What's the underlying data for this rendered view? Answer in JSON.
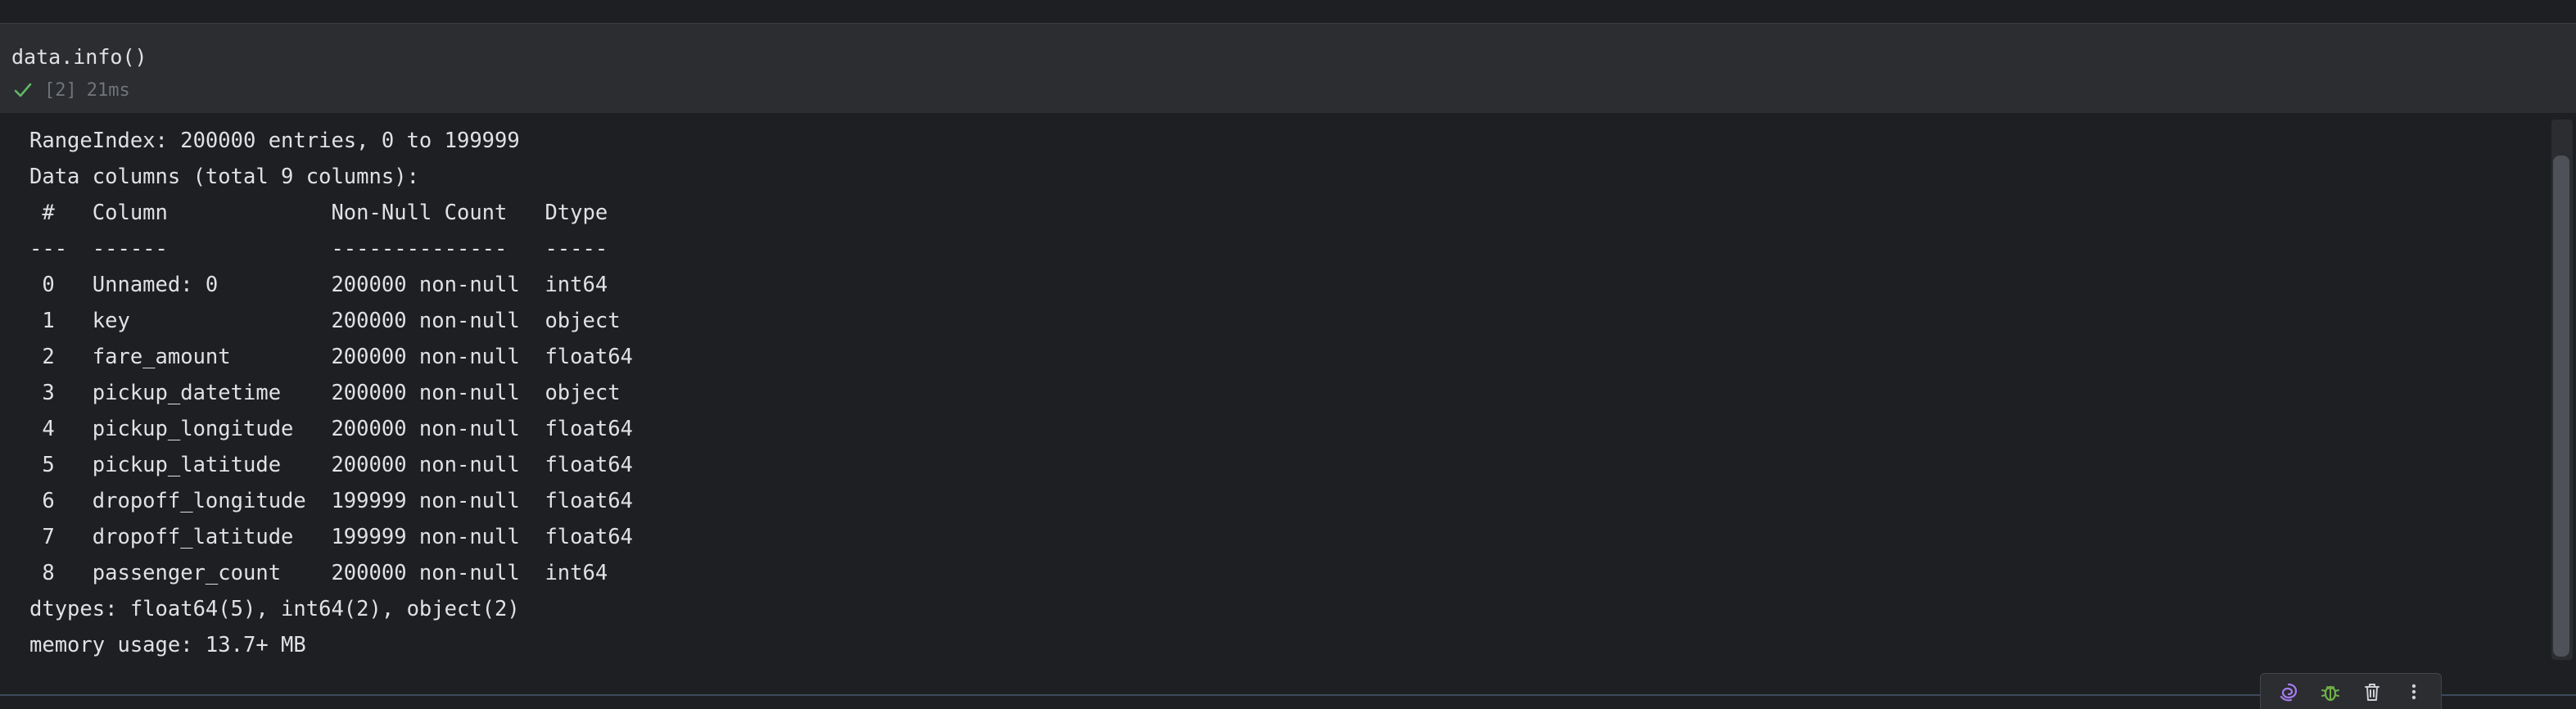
{
  "cell": {
    "code": "data.info()",
    "exec_count": "[2]",
    "duration": "21ms",
    "status_icon": "check-icon"
  },
  "output": {
    "lines": [
      "RangeIndex: 200000 entries, 0 to 199999",
      "Data columns (total 9 columns):",
      " #   Column             Non-Null Count   Dtype  ",
      "---  ------             --------------   -----  ",
      " 0   Unnamed: 0         200000 non-null  int64  ",
      " 1   key                200000 non-null  object ",
      " 2   fare_amount        200000 non-null  float64",
      " 3   pickup_datetime    200000 non-null  object ",
      " 4   pickup_longitude   200000 non-null  float64",
      " 5   pickup_latitude    200000 non-null  float64",
      " 6   dropoff_longitude  199999 non-null  float64",
      " 7   dropoff_latitude   199999 non-null  float64",
      " 8   passenger_count    200000 non-null  int64  ",
      "dtypes: float64(5), int64(2), object(2)",
      "memory usage: 13.7+ MB"
    ]
  },
  "toolbar": {
    "buttons": [
      {
        "icon": "ai-assistant-icon"
      },
      {
        "icon": "debug-icon"
      },
      {
        "icon": "trash-icon"
      },
      {
        "icon": "more-vertical-icon"
      }
    ]
  },
  "colors": {
    "background": "#1e1f22",
    "cell_input_bg": "#2b2d30",
    "text": "#dfe1e5",
    "muted_text": "#6f737a",
    "success_green": "#5fb865",
    "ai_purple": "#a67cf0",
    "debug_green": "#6fb24a"
  }
}
